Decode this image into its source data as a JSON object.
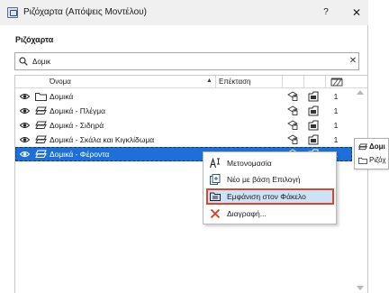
{
  "window": {
    "title": "Ριζόχαρτα (Απόψεις Μοντέλου)",
    "help_label": "?",
    "close_label": "✕"
  },
  "section_title": "Ριζόχαρτα",
  "search": {
    "value": "Δομικ",
    "placeholder": "",
    "clear_label": "✕"
  },
  "table": {
    "columns": {
      "name": "Όνομα",
      "extension": "Επέκταση",
      "sort_indicator": "▲"
    },
    "rows": [
      {
        "icon": "folder-icon",
        "name": "Δομικά",
        "count": "1",
        "selected": false
      },
      {
        "icon": "layer-icon",
        "name": "Δομικά - Πλέγμα",
        "count": "1",
        "selected": false
      },
      {
        "icon": "layer-icon",
        "name": "Δομικά - Σιδηρά",
        "count": "1",
        "selected": false
      },
      {
        "icon": "layer-icon",
        "name": "Δομικά - Σκάλα και Κιγκλίδωμα",
        "count": "1",
        "selected": false
      },
      {
        "icon": "layer-icon",
        "name": "Δομικά - Φέροντα",
        "count": "1",
        "selected": true
      }
    ]
  },
  "tooltip": {
    "line1": "Δομι",
    "line2": "Ριζόχ"
  },
  "context_menu": {
    "items": [
      {
        "icon": "rename-icon",
        "label": "Μετονομασία",
        "highlighted": false
      },
      {
        "icon": "new-from-selection-icon",
        "label": "Νέο με βάση Επιλογή",
        "highlighted": false
      },
      {
        "icon": "show-in-folder-icon",
        "label": "Εμφάνιση στον Φάκελο",
        "highlighted": true
      },
      {
        "icon": "delete-icon",
        "label": "Διαγραφή...",
        "highlighted": false
      }
    ]
  },
  "colors": {
    "selection": "#1e6fd9",
    "menu_highlight": "#cce3f7",
    "highlight_border": "#e0452b",
    "delete_icon": "#d9381e"
  }
}
